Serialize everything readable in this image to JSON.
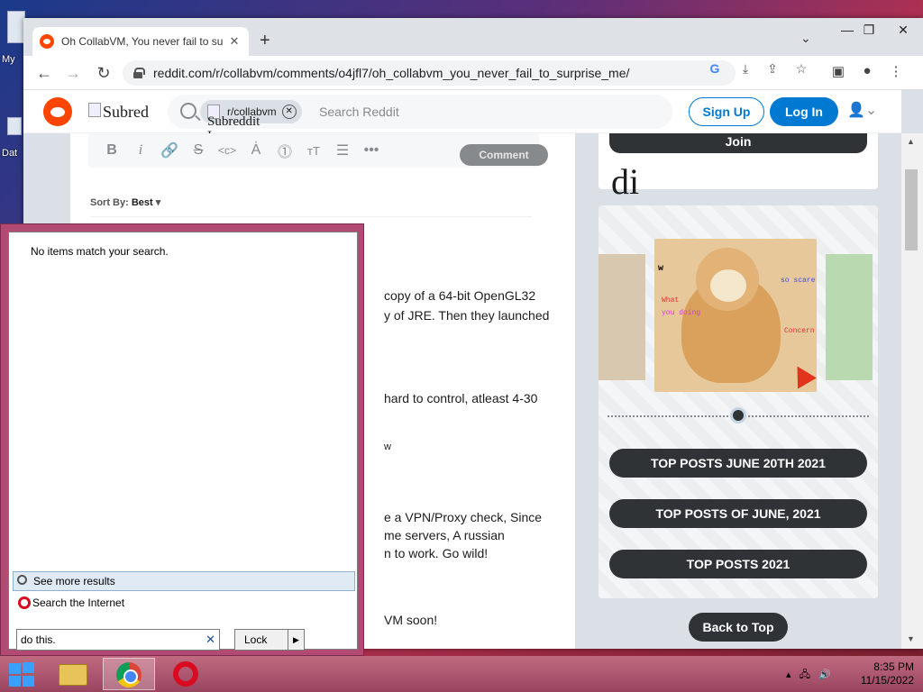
{
  "desktop": {
    "icon_labels": [
      "My",
      "Dat"
    ]
  },
  "browser": {
    "tab_title": "Oh CollabVM, You never fail to su",
    "url": "reddit.com/r/collabvm/comments/o4jfl7/oh_collabvm_you_never_fail_to_surprise_me/"
  },
  "reddit": {
    "subreddit_alt": "Subred",
    "chip_label": "r/collabvm",
    "chip_alt": "Subreddit Icon",
    "search_placeholder": "Search Reddit",
    "signup_label": "Sign Up",
    "login_label": "Log In",
    "comment_button": "Comment",
    "sort_by_label": "Sort By:",
    "sort_by_value": "Best",
    "comment_fragments": [
      "copy of a 64-bit OpenGL32",
      "y of JRE. Then they launched",
      "hard to control, atleast 4-30",
      "w",
      "e a VPN/Proxy check, Since",
      "me servers, A russian",
      "n to work. Go wild!",
      "VM soon!"
    ]
  },
  "sidebar": {
    "join_label": "Join",
    "di_text": "di",
    "meme_text": [
      "w",
      "What",
      "you doing",
      "so scare",
      "Concern"
    ],
    "pills": [
      "TOP POSTS JUNE 20TH 2021",
      "TOP POSTS OF JUNE, 2021",
      "TOP POSTS 2021"
    ],
    "back_to_top": "Back to Top"
  },
  "start_menu": {
    "no_items": "No items match your search.",
    "see_more": "See more results",
    "search_internet": "Search the Internet",
    "search_value": "do this.",
    "lock_label": "Lock"
  },
  "taskbar": {
    "time": "8:35 PM",
    "date": "11/15/2022"
  },
  "colors": {
    "reddit_orange": "#ff4500",
    "reddit_blue": "#0079d3",
    "pill_dark": "#2f3336",
    "start_menu_frame": "#b24a73"
  }
}
